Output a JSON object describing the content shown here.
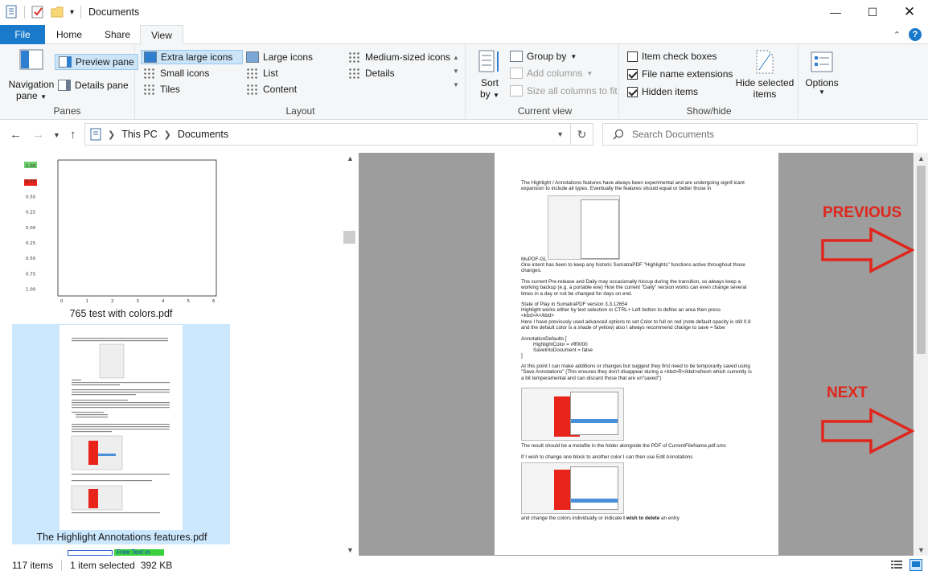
{
  "window": {
    "title": "Documents"
  },
  "ribbon_tabs": {
    "file": "File",
    "home": "Home",
    "share": "Share",
    "view": "View"
  },
  "panes": {
    "navigation_pane": "Navigation",
    "navigation_pane_2": "pane",
    "preview_pane": "Preview pane",
    "details_pane": "Details pane",
    "label": "Panes"
  },
  "layout": {
    "extra_large": "Extra large icons",
    "large": "Large icons",
    "medium": "Medium-sized icons",
    "small": "Small icons",
    "list": "List",
    "details": "Details",
    "tiles": "Tiles",
    "content": "Content",
    "label": "Layout"
  },
  "current_view": {
    "sort_by_1": "Sort",
    "sort_by_2": "by",
    "group_by": "Group by",
    "add_columns": "Add columns",
    "size_all_columns": "Size all columns to fit",
    "label": "Current view"
  },
  "show_hide": {
    "item_check_boxes": "Item check boxes",
    "file_name_extensions": "File name extensions",
    "hidden_items": "Hidden items",
    "hide_selected_1": "Hide selected",
    "hide_selected_2": "items",
    "label": "Show/hide"
  },
  "options": {
    "label": "Options"
  },
  "address": {
    "crumbs": [
      "This PC",
      "Documents"
    ]
  },
  "search": {
    "placeholder": "Search Documents"
  },
  "files": [
    {
      "name": "765 test with colors.pdf",
      "axis": [
        "1.00",
        "0.75",
        "0.50",
        "0.25",
        "0.00",
        "0.25",
        "0.50",
        "0.75",
        "1.00"
      ],
      "xticks": [
        "0",
        "1",
        "2",
        "3",
        "4",
        "5",
        "6"
      ]
    },
    {
      "name": "The Highlight  Annotations features.pdf"
    },
    {
      "name": "Free Text in Blue"
    }
  ],
  "preview": {
    "p1": "The Highlight / Annotations features have always been experimental and are undergoing signif-icant expansion to include all types. Eventually the features should equal or better those in",
    "p2": "MuPDF-GL",
    "p3": "One intent has been to keep any historic SumatraPDF \"Highlights\" functions active throughout those changes.",
    "p4": "The current Pre-release and Daily may occasionally hiccup during the transition, so always keep a working backup (e.g. a portable exe) How the current \"Daily\" version works can even change several times in a day or not be changed for days on end.",
    "p5": "State of Play in SumatraPDF version 3.3.12654",
    "p6": "Highlight works either by text selection or CTRL+ Left button to define an area then press <kbd>A</kbd>",
    "p7": "Here I have previously used advanced options to set Color to full on red (note default opacity is still 0.8 and the default color is a shade of yellow) also I always recommend change to save = false",
    "p8": "AnnotationDefaults [",
    "p9": "HighlightColor = #ff0000",
    "p10": "SaveIntoDocument = false",
    "p11": "]",
    "p12": "At this point I can make additions or changes but suggest they first need to be temporarily saved using \"Save Annotations\" (This ensures they don't disappear during a <kbd>R</kbd>efresh which currently is a bit temperamental and can discard those that are un\"saved\")",
    "p13": "The result should be a metafile in the folder alongside the PDF of CurrentFileName.pdf.smx",
    "p14": "If I wish to change one block to another color I can then use Edit Annotations",
    "p15a": "and change the colors individually or indicate ",
    "p15b": "I wish to delete",
    "p15c": " an entry"
  },
  "annotations": {
    "previous": "PREVIOUS",
    "next": "NEXT"
  },
  "status": {
    "items": "117 items",
    "selected": "1 item selected",
    "size": "392 KB"
  }
}
